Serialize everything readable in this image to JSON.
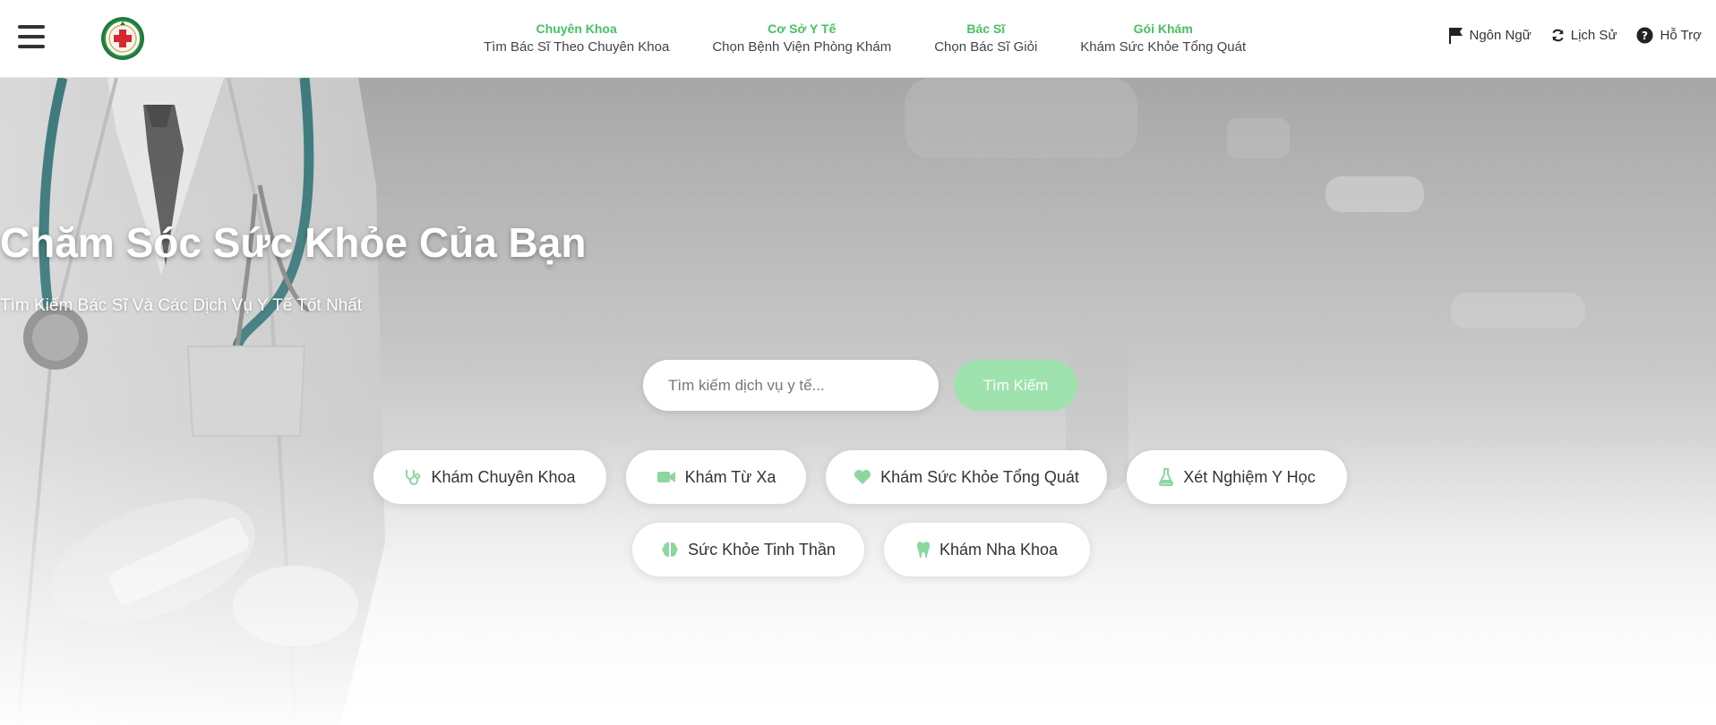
{
  "header": {
    "nav": [
      {
        "title": "Chuyên Khoa",
        "subtitle": "Tìm Bác Sĩ Theo Chuyên Khoa"
      },
      {
        "title": "Cơ Sở Y Tế",
        "subtitle": "Chọn Bệnh Viện Phòng Khám"
      },
      {
        "title": "Bác Sĩ",
        "subtitle": "Chọn Bác Sĩ Giỏi"
      },
      {
        "title": "Gói Khám",
        "subtitle": "Khám Sức Khỏe Tổng Quát"
      }
    ],
    "utils": [
      {
        "label": "Ngôn Ngữ",
        "icon": "flag-icon"
      },
      {
        "label": "Lịch Sử",
        "icon": "refresh-icon"
      },
      {
        "label": "Hỗ Trợ",
        "icon": "question-circle-icon"
      }
    ]
  },
  "hero": {
    "title": "Chăm Sóc Sức Khỏe Của Bạn",
    "subtitle": "Tìm Kiếm Bác Sĩ Và Các Dịch Vụ Y Tế Tốt Nhất",
    "search_placeholder": "Tìm kiếm dịch vụ y tế...",
    "search_button": "Tìm Kiếm"
  },
  "services": [
    {
      "label": "Khám Chuyên Khoa",
      "icon": "stethoscope-icon"
    },
    {
      "label": "Khám Từ Xa",
      "icon": "video-icon"
    },
    {
      "label": "Khám Sức Khỏe Tổng Quát",
      "icon": "heart-icon"
    },
    {
      "label": "Xét Nghiệm Y Học",
      "icon": "flask-icon"
    },
    {
      "label": "Sức Khỏe Tinh Thần",
      "icon": "brain-icon"
    },
    {
      "label": "Khám Nha Khoa",
      "icon": "tooth-icon"
    }
  ],
  "colors": {
    "accent": "#45c35e",
    "accent_light": "#9ee3ad",
    "icon_green": "#8bd89f"
  }
}
